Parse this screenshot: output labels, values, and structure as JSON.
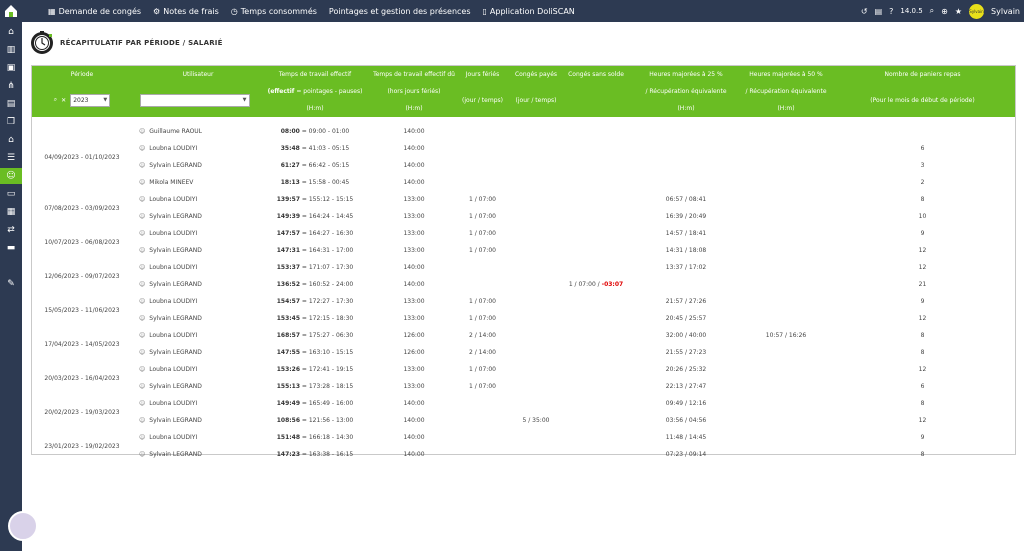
{
  "topnav": [
    {
      "icon": "calendar-icon",
      "glyph": "▦",
      "label": "Demande de congés"
    },
    {
      "icon": "bicycle-icon",
      "glyph": "⚙",
      "label": "Notes de frais"
    },
    {
      "icon": "clock-icon",
      "glyph": "◷",
      "label": "Temps consommés"
    },
    {
      "icon": "",
      "glyph": "",
      "label": "Pointages et gestion des présences"
    },
    {
      "icon": "phone-icon",
      "glyph": "▯",
      "label": "Application DoliSCAN"
    }
  ],
  "topright": {
    "version": "14.0.5",
    "user": "Sylvain",
    "avatar_text": "Sylvain"
  },
  "page_title": "RÉCAPITULATIF PAR PÉRIODE / SALARIÉ",
  "headers": {
    "periode": "Période",
    "utilisateur": "Utilisateur",
    "tte_1": "Temps de travail effectif",
    "tte_2a": "(effectif",
    "tte_2b": " = pointages - pauses)",
    "tte_3": "(H:m)",
    "ttd_1": "Temps de travail effectif dû",
    "ttd_2": "(hors jours fériés)",
    "ttd_3": "(H:m)",
    "jf_1": "Jours fériés",
    "jf_2": "(jour / temps)",
    "cp_1": "Congés payés",
    "cp_2": "(jour / temps)",
    "css_1": "Congés sans solde",
    "h25_1": "Heures majorées à 25 %",
    "h25_2": "/ Récupération équivalente",
    "h25_3": "(H:m)",
    "h50_1": "Heures majorées à 50 %",
    "h50_2": "/ Récupération équivalente",
    "h50_3": "(H:m)",
    "pan_1": "Nombre de paniers repas",
    "pan_2": "(Pour le mois de début de période)"
  },
  "filters": {
    "year": "2023",
    "user": ""
  },
  "groups": [
    {
      "periode": "04/09/2023 - 01/10/2023",
      "rows": [
        {
          "user": "Guillaume RAOUL",
          "tte_b": "08:00",
          "tte": " = 09:00 - 01:00",
          "ttd": "140:00",
          "jf": "",
          "cp": "",
          "css": "",
          "css_neg": "",
          "h25": "",
          "h50": "",
          "pan": ""
        },
        {
          "user": "Loubna LOUDIYI",
          "tte_b": "35:48",
          "tte": " = 41:03 - 05:15",
          "ttd": "140:00",
          "jf": "",
          "cp": "",
          "css": "",
          "css_neg": "",
          "h25": "",
          "h50": "",
          "pan": "6"
        },
        {
          "user": "Sylvain LEGRAND",
          "tte_b": "61:27",
          "tte": " = 66:42 - 05:15",
          "ttd": "140:00",
          "jf": "",
          "cp": "",
          "css": "",
          "css_neg": "",
          "h25": "",
          "h50": "",
          "pan": "3"
        },
        {
          "user": "Mikola MINEEV",
          "tte_b": "18:13",
          "tte": " = 15:58 - 00:45",
          "ttd": "140:00",
          "jf": "",
          "cp": "",
          "css": "",
          "css_neg": "",
          "h25": "",
          "h50": "",
          "pan": "2"
        }
      ]
    },
    {
      "periode": "07/08/2023 - 03/09/2023",
      "rows": [
        {
          "user": "Loubna LOUDIYI",
          "tte_b": "139:57",
          "tte": " = 155:12 - 15:15",
          "ttd": "133:00",
          "jf": "1 / 07:00",
          "cp": "",
          "css": "",
          "css_neg": "",
          "h25": "06:57 / 08:41",
          "h50": "",
          "pan": "8"
        },
        {
          "user": "Sylvain LEGRAND",
          "tte_b": "149:39",
          "tte": " = 164:24 - 14:45",
          "ttd": "133:00",
          "jf": "1 / 07:00",
          "cp": "",
          "css": "",
          "css_neg": "",
          "h25": "16:39 / 20:49",
          "h50": "",
          "pan": "10"
        }
      ]
    },
    {
      "periode": "10/07/2023 - 06/08/2023",
      "rows": [
        {
          "user": "Loubna LOUDIYI",
          "tte_b": "147:57",
          "tte": " = 164:27 - 16:30",
          "ttd": "133:00",
          "jf": "1 / 07:00",
          "cp": "",
          "css": "",
          "css_neg": "",
          "h25": "14:57 / 18:41",
          "h50": "",
          "pan": "9"
        },
        {
          "user": "Sylvain LEGRAND",
          "tte_b": "147:31",
          "tte": " = 164:31 - 17:00",
          "ttd": "133:00",
          "jf": "1 / 07:00",
          "cp": "",
          "css": "",
          "css_neg": "",
          "h25": "14:31 / 18:08",
          "h50": "",
          "pan": "12"
        }
      ]
    },
    {
      "periode": "12/06/2023 - 09/07/2023",
      "rows": [
        {
          "user": "Loubna LOUDIYI",
          "tte_b": "153:37",
          "tte": " = 171:07 - 17:30",
          "ttd": "140:00",
          "jf": "",
          "cp": "",
          "css": "",
          "css_neg": "",
          "h25": "13:37 / 17:02",
          "h50": "",
          "pan": "12"
        },
        {
          "user": "Sylvain LEGRAND",
          "tte_b": "136:52",
          "tte": " = 160:52 - 24:00",
          "ttd": "140:00",
          "jf": "",
          "cp": "",
          "css": "1 / 07:00 / ",
          "css_neg": "-03:07",
          "h25": "",
          "h50": "",
          "pan": "21"
        }
      ]
    },
    {
      "periode": "15/05/2023 - 11/06/2023",
      "rows": [
        {
          "user": "Loubna LOUDIYI",
          "tte_b": "154:57",
          "tte": " = 172:27 - 17:30",
          "ttd": "133:00",
          "jf": "1 / 07:00",
          "cp": "",
          "css": "",
          "css_neg": "",
          "h25": "21:57 / 27:26",
          "h50": "",
          "pan": "9"
        },
        {
          "user": "Sylvain LEGRAND",
          "tte_b": "153:45",
          "tte": " = 172:15 - 18:30",
          "ttd": "133:00",
          "jf": "1 / 07:00",
          "cp": "",
          "css": "",
          "css_neg": "",
          "h25": "20:45 / 25:57",
          "h50": "",
          "pan": "12"
        }
      ]
    },
    {
      "periode": "17/04/2023 - 14/05/2023",
      "rows": [
        {
          "user": "Loubna LOUDIYI",
          "tte_b": "168:57",
          "tte": " = 175:27 - 06:30",
          "ttd": "126:00",
          "jf": "2 / 14:00",
          "cp": "",
          "css": "",
          "css_neg": "",
          "h25": "32:00 / 40:00",
          "h50": "10:57 / 16:26",
          "pan": "8"
        },
        {
          "user": "Sylvain LEGRAND",
          "tte_b": "147:55",
          "tte": " = 163:10 - 15:15",
          "ttd": "126:00",
          "jf": "2 / 14:00",
          "cp": "",
          "css": "",
          "css_neg": "",
          "h25": "21:55 / 27:23",
          "h50": "",
          "pan": "8"
        }
      ]
    },
    {
      "periode": "20/03/2023 - 16/04/2023",
      "rows": [
        {
          "user": "Loubna LOUDIYI",
          "tte_b": "153:26",
          "tte": " = 172:41 - 19:15",
          "ttd": "133:00",
          "jf": "1 / 07:00",
          "cp": "",
          "css": "",
          "css_neg": "",
          "h25": "20:26 / 25:32",
          "h50": "",
          "pan": "12"
        },
        {
          "user": "Sylvain LEGRAND",
          "tte_b": "155:13",
          "tte": " = 173:28 - 18:15",
          "ttd": "133:00",
          "jf": "1 / 07:00",
          "cp": "",
          "css": "",
          "css_neg": "",
          "h25": "22:13 / 27:47",
          "h50": "",
          "pan": "6"
        }
      ]
    },
    {
      "periode": "20/02/2023 - 19/03/2023",
      "rows": [
        {
          "user": "Loubna LOUDIYI",
          "tte_b": "149:49",
          "tte": " = 165:49 - 16:00",
          "ttd": "140:00",
          "jf": "",
          "cp": "",
          "css": "",
          "css_neg": "",
          "h25": "09:49 / 12:16",
          "h50": "",
          "pan": "8"
        },
        {
          "user": "Sylvain LEGRAND",
          "tte_b": "108:56",
          "tte": " = 121:56 - 13:00",
          "ttd": "140:00",
          "jf": "",
          "cp": "5 / 35:00",
          "css": "",
          "css_neg": "",
          "h25": "03:56 / 04:56",
          "h50": "",
          "pan": "12"
        }
      ]
    },
    {
      "periode": "23/01/2023 - 19/02/2023",
      "rows": [
        {
          "user": "Loubna LOUDIYI",
          "tte_b": "151:48",
          "tte": " = 166:18 - 14:30",
          "ttd": "140:00",
          "jf": "",
          "cp": "",
          "css": "",
          "css_neg": "",
          "h25": "11:48 / 14:45",
          "h50": "",
          "pan": "9"
        },
        {
          "user": "Sylvain LEGRAND",
          "tte_b": "147:23",
          "tte": " = 163:38 - 16:15",
          "ttd": "140:00",
          "jf": "",
          "cp": "",
          "css": "",
          "css_neg": "",
          "h25": "07:23 / 09:14",
          "h50": "",
          "pan": "8"
        }
      ]
    }
  ],
  "colors": {
    "accent": "#6abd23",
    "navbar": "#2d3a52",
    "negative": "#e00000"
  }
}
